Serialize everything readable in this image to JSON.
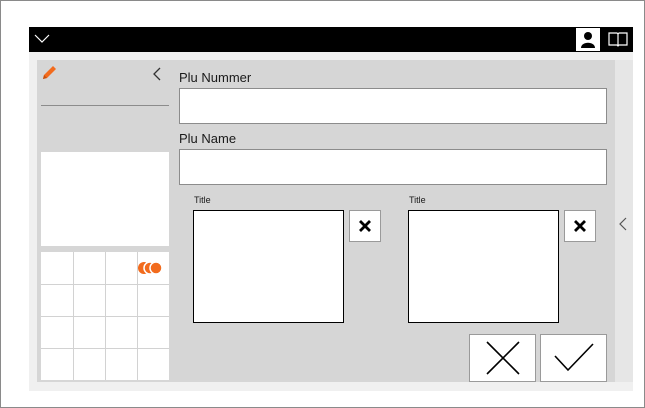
{
  "icons": {
    "menu": "chevron-down-icon",
    "user": "user-icon",
    "manual": "book-icon",
    "edit": "pencil-icon",
    "back": "chevron-left-icon",
    "expand": "chevron-left-icon",
    "colors": "color-dots-icon"
  },
  "colors": {
    "accent": "#f26b1d",
    "titlebar": "#000000",
    "panel": "#d6d6d6"
  },
  "form": {
    "plu_number_label": "Plu Nummer",
    "plu_number_value": "",
    "plu_name_label": "Plu Name",
    "plu_name_value": "",
    "image1_title": "Title",
    "image2_title": "Title"
  }
}
